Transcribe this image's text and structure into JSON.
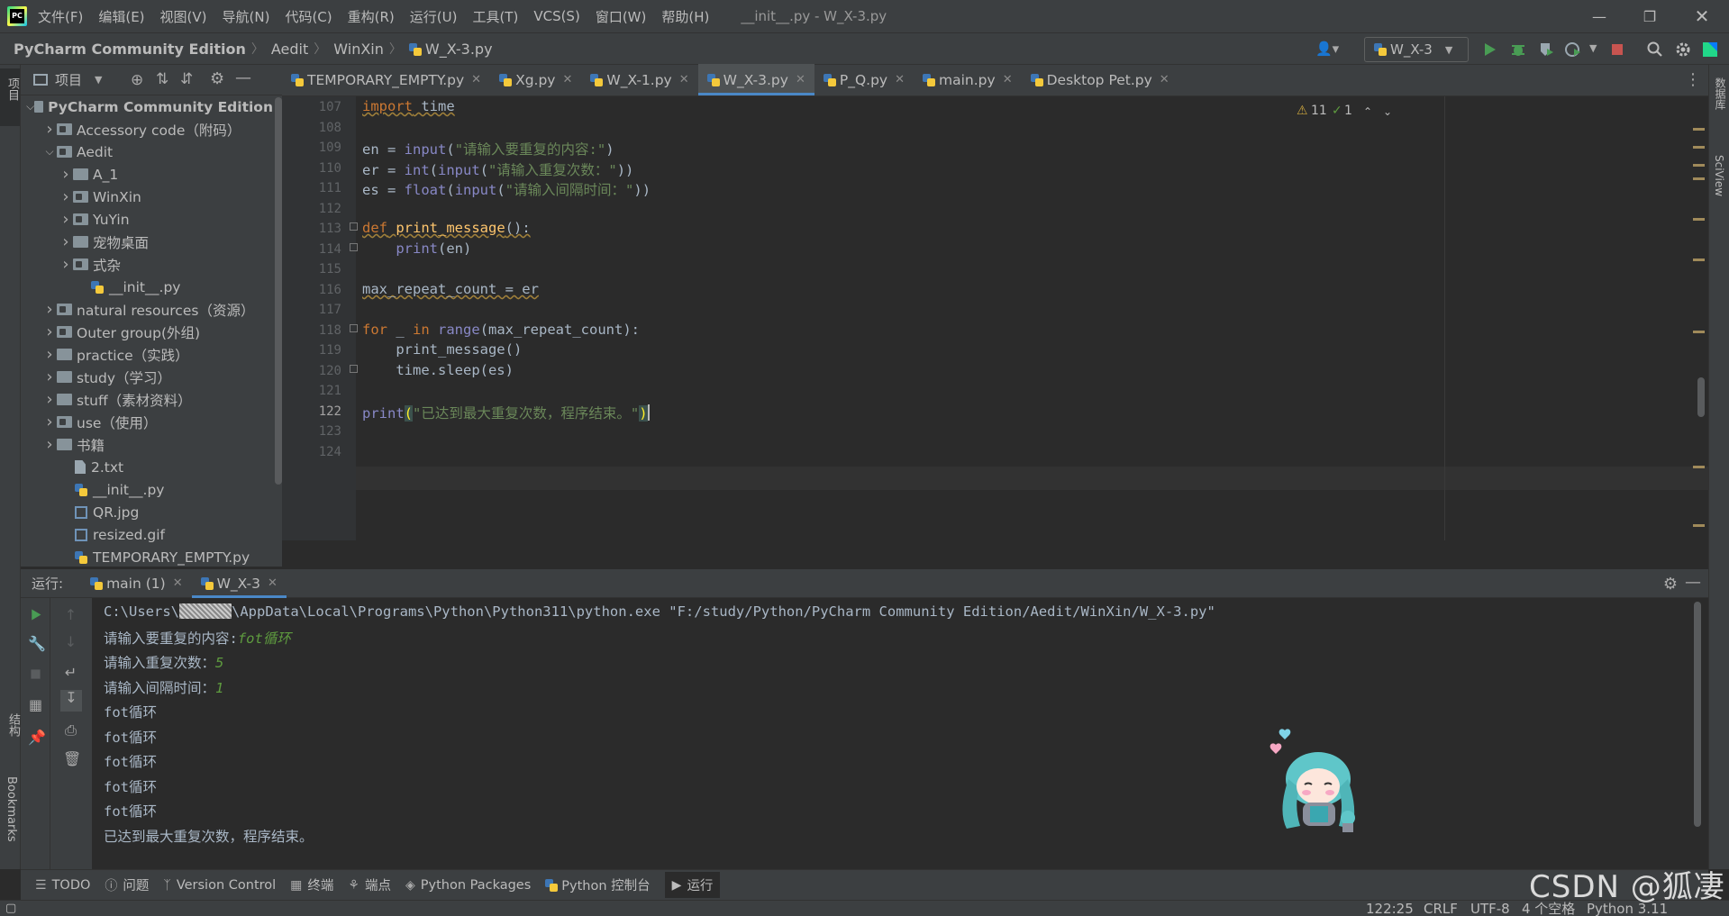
{
  "menubar": {
    "items": [
      "文件(F)",
      "编辑(E)",
      "视图(V)",
      "导航(N)",
      "代码(C)",
      "重构(R)",
      "运行(U)",
      "工具(T)",
      "VCS(S)",
      "窗口(W)",
      "帮助(H)"
    ],
    "window_title": "__init__.py - W_X-3.py"
  },
  "breadcrumb": [
    "PyCharm Community Edition",
    "Aedit",
    "WinXin",
    "W_X-3.py"
  ],
  "run_config": {
    "label": "W_X-3"
  },
  "left_stripe": {
    "project_label": "项目",
    "structure_label": "结构",
    "bookmarks_label": "Bookmarks"
  },
  "right_stripe": {
    "database_label": "数据库",
    "sciview_label": "SciView"
  },
  "project_panel": {
    "title": "项目",
    "tree": [
      {
        "label": "PyCharm Community Edition",
        "level": 0,
        "kind": "folder",
        "expanded": true,
        "bold": true
      },
      {
        "label": "Accessory code（附码）",
        "level": 1,
        "kind": "folder-mod",
        "expanded": false
      },
      {
        "label": "Aedit",
        "level": 1,
        "kind": "folder-mod",
        "expanded": true
      },
      {
        "label": "A_1",
        "level": 2,
        "kind": "folder",
        "expanded": false
      },
      {
        "label": "WinXin",
        "level": 2,
        "kind": "folder-mod",
        "expanded": false
      },
      {
        "label": "YuYin",
        "level": 2,
        "kind": "folder-mod",
        "expanded": false
      },
      {
        "label": "宠物桌面",
        "level": 2,
        "kind": "folder",
        "expanded": false
      },
      {
        "label": "式杂",
        "level": 2,
        "kind": "folder-mod",
        "expanded": false
      },
      {
        "label": "__init__.py",
        "level": 3,
        "kind": "py"
      },
      {
        "label": "natural resources（资源）",
        "level": 1,
        "kind": "folder-mod",
        "expanded": false
      },
      {
        "label": "Outer group(外组)",
        "level": 1,
        "kind": "folder-mod",
        "expanded": false
      },
      {
        "label": "practice（实践）",
        "level": 1,
        "kind": "folder",
        "expanded": false
      },
      {
        "label": "study（学习）",
        "level": 1,
        "kind": "folder",
        "expanded": false
      },
      {
        "label": "stuff（素材资料）",
        "level": 1,
        "kind": "folder",
        "expanded": false
      },
      {
        "label": "use（使用）",
        "level": 1,
        "kind": "folder-mod",
        "expanded": false
      },
      {
        "label": "书籍",
        "level": 1,
        "kind": "folder",
        "expanded": false
      },
      {
        "label": "2.txt",
        "level": 2,
        "kind": "txt"
      },
      {
        "label": "__init__.py",
        "level": 2,
        "kind": "py"
      },
      {
        "label": "QR.jpg",
        "level": 2,
        "kind": "img"
      },
      {
        "label": "resized.gif",
        "level": 2,
        "kind": "img"
      },
      {
        "label": "TEMPORARY_EMPTY.py",
        "level": 2,
        "kind": "py"
      }
    ]
  },
  "editor_tabs": [
    {
      "label": "TEMPORARY_EMPTY.py",
      "active": false
    },
    {
      "label": "Xg.py",
      "active": false
    },
    {
      "label": "W_X-1.py",
      "active": false
    },
    {
      "label": "W_X-3.py",
      "active": true
    },
    {
      "label": "P_Q.py",
      "active": false
    },
    {
      "label": "main.py",
      "active": false
    },
    {
      "label": "Desktop Pet.py",
      "active": false
    }
  ],
  "editor": {
    "inspections": {
      "warnings": "11",
      "checks": "1"
    },
    "current_line": "122",
    "line_numbers": [
      "107",
      "108",
      "109",
      "110",
      "111",
      "112",
      "113",
      "114",
      "115",
      "116",
      "117",
      "118",
      "119",
      "120",
      "121",
      "122",
      "123",
      "124"
    ]
  },
  "run_panel": {
    "label": "运行:",
    "tabs": [
      {
        "label": "main (1)",
        "active": false
      },
      {
        "label": "W_X-3",
        "active": true
      }
    ],
    "console": {
      "cmd_prefix": "C:\\Users\\",
      "cmd_suffix": "\\AppData\\Local\\Programs\\Python\\Python311\\python.exe \"F:/study/Python/PyCharm Community Edition/Aedit/WinXin/W_X-3.py\"",
      "prompt1": "请输入要重复的内容:",
      "input1": "fot循环",
      "prompt2": "请输入重复次数：",
      "input2": "5",
      "prompt3": "请输入间隔时间：",
      "input3": "1",
      "outputs": [
        "fot循环",
        "fot循环",
        "fot循环",
        "fot循环",
        "fot循环"
      ],
      "final": "已达到最大重复次数，程序结束。"
    }
  },
  "bottom_tools": [
    {
      "label": "TODO",
      "icon": "list-icon"
    },
    {
      "label": "问题",
      "icon": "problems-icon"
    },
    {
      "label": "Version Control",
      "icon": "vcs-icon"
    },
    {
      "label": "终端",
      "icon": "terminal-icon"
    },
    {
      "label": "端点",
      "icon": "endpoints-icon"
    },
    {
      "label": "Python Packages",
      "icon": "packages-icon"
    },
    {
      "label": "Python 控制台",
      "icon": "python-console-icon"
    },
    {
      "label": "运行",
      "icon": "run-icon"
    }
  ],
  "statusbar": {
    "position": "122:25",
    "line_sep": "CRLF",
    "encoding": "UTF-8",
    "indent": "4 个空格",
    "interpreter": "Python 3.11"
  },
  "watermark": "CSDN @狐凄",
  "colors": {
    "bg_editor": "#2b2b2b",
    "bg_panel": "#3c3f41",
    "keyword": "#cc7832",
    "string": "#6a8759",
    "builtin": "#8888c6",
    "accent": "#4a88c7"
  }
}
